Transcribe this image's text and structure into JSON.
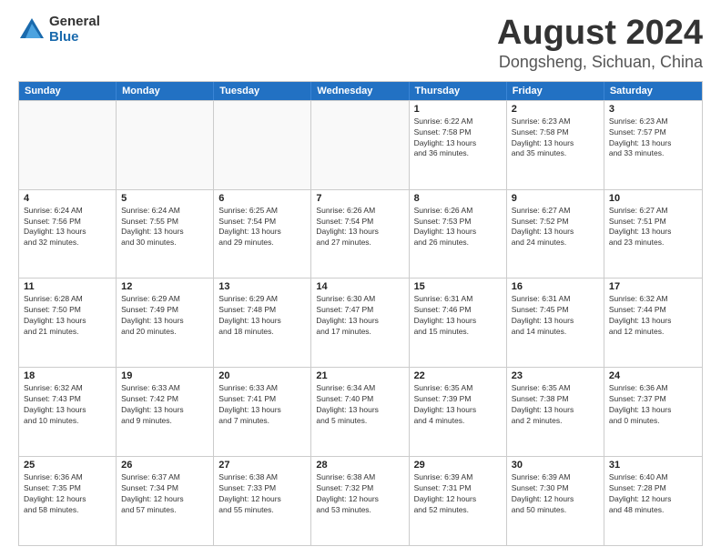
{
  "header": {
    "logo_general": "General",
    "logo_blue": "Blue",
    "month_title": "August 2024",
    "location": "Dongsheng, Sichuan, China"
  },
  "days_of_week": [
    "Sunday",
    "Monday",
    "Tuesday",
    "Wednesday",
    "Thursday",
    "Friday",
    "Saturday"
  ],
  "weeks": [
    [
      {
        "day": "",
        "text": ""
      },
      {
        "day": "",
        "text": ""
      },
      {
        "day": "",
        "text": ""
      },
      {
        "day": "",
        "text": ""
      },
      {
        "day": "1",
        "text": "Sunrise: 6:22 AM\nSunset: 7:58 PM\nDaylight: 13 hours\nand 36 minutes."
      },
      {
        "day": "2",
        "text": "Sunrise: 6:23 AM\nSunset: 7:58 PM\nDaylight: 13 hours\nand 35 minutes."
      },
      {
        "day": "3",
        "text": "Sunrise: 6:23 AM\nSunset: 7:57 PM\nDaylight: 13 hours\nand 33 minutes."
      }
    ],
    [
      {
        "day": "4",
        "text": "Sunrise: 6:24 AM\nSunset: 7:56 PM\nDaylight: 13 hours\nand 32 minutes."
      },
      {
        "day": "5",
        "text": "Sunrise: 6:24 AM\nSunset: 7:55 PM\nDaylight: 13 hours\nand 30 minutes."
      },
      {
        "day": "6",
        "text": "Sunrise: 6:25 AM\nSunset: 7:54 PM\nDaylight: 13 hours\nand 29 minutes."
      },
      {
        "day": "7",
        "text": "Sunrise: 6:26 AM\nSunset: 7:54 PM\nDaylight: 13 hours\nand 27 minutes."
      },
      {
        "day": "8",
        "text": "Sunrise: 6:26 AM\nSunset: 7:53 PM\nDaylight: 13 hours\nand 26 minutes."
      },
      {
        "day": "9",
        "text": "Sunrise: 6:27 AM\nSunset: 7:52 PM\nDaylight: 13 hours\nand 24 minutes."
      },
      {
        "day": "10",
        "text": "Sunrise: 6:27 AM\nSunset: 7:51 PM\nDaylight: 13 hours\nand 23 minutes."
      }
    ],
    [
      {
        "day": "11",
        "text": "Sunrise: 6:28 AM\nSunset: 7:50 PM\nDaylight: 13 hours\nand 21 minutes."
      },
      {
        "day": "12",
        "text": "Sunrise: 6:29 AM\nSunset: 7:49 PM\nDaylight: 13 hours\nand 20 minutes."
      },
      {
        "day": "13",
        "text": "Sunrise: 6:29 AM\nSunset: 7:48 PM\nDaylight: 13 hours\nand 18 minutes."
      },
      {
        "day": "14",
        "text": "Sunrise: 6:30 AM\nSunset: 7:47 PM\nDaylight: 13 hours\nand 17 minutes."
      },
      {
        "day": "15",
        "text": "Sunrise: 6:31 AM\nSunset: 7:46 PM\nDaylight: 13 hours\nand 15 minutes."
      },
      {
        "day": "16",
        "text": "Sunrise: 6:31 AM\nSunset: 7:45 PM\nDaylight: 13 hours\nand 14 minutes."
      },
      {
        "day": "17",
        "text": "Sunrise: 6:32 AM\nSunset: 7:44 PM\nDaylight: 13 hours\nand 12 minutes."
      }
    ],
    [
      {
        "day": "18",
        "text": "Sunrise: 6:32 AM\nSunset: 7:43 PM\nDaylight: 13 hours\nand 10 minutes."
      },
      {
        "day": "19",
        "text": "Sunrise: 6:33 AM\nSunset: 7:42 PM\nDaylight: 13 hours\nand 9 minutes."
      },
      {
        "day": "20",
        "text": "Sunrise: 6:33 AM\nSunset: 7:41 PM\nDaylight: 13 hours\nand 7 minutes."
      },
      {
        "day": "21",
        "text": "Sunrise: 6:34 AM\nSunset: 7:40 PM\nDaylight: 13 hours\nand 5 minutes."
      },
      {
        "day": "22",
        "text": "Sunrise: 6:35 AM\nSunset: 7:39 PM\nDaylight: 13 hours\nand 4 minutes."
      },
      {
        "day": "23",
        "text": "Sunrise: 6:35 AM\nSunset: 7:38 PM\nDaylight: 13 hours\nand 2 minutes."
      },
      {
        "day": "24",
        "text": "Sunrise: 6:36 AM\nSunset: 7:37 PM\nDaylight: 13 hours\nand 0 minutes."
      }
    ],
    [
      {
        "day": "25",
        "text": "Sunrise: 6:36 AM\nSunset: 7:35 PM\nDaylight: 12 hours\nand 58 minutes."
      },
      {
        "day": "26",
        "text": "Sunrise: 6:37 AM\nSunset: 7:34 PM\nDaylight: 12 hours\nand 57 minutes."
      },
      {
        "day": "27",
        "text": "Sunrise: 6:38 AM\nSunset: 7:33 PM\nDaylight: 12 hours\nand 55 minutes."
      },
      {
        "day": "28",
        "text": "Sunrise: 6:38 AM\nSunset: 7:32 PM\nDaylight: 12 hours\nand 53 minutes."
      },
      {
        "day": "29",
        "text": "Sunrise: 6:39 AM\nSunset: 7:31 PM\nDaylight: 12 hours\nand 52 minutes."
      },
      {
        "day": "30",
        "text": "Sunrise: 6:39 AM\nSunset: 7:30 PM\nDaylight: 12 hours\nand 50 minutes."
      },
      {
        "day": "31",
        "text": "Sunrise: 6:40 AM\nSunset: 7:28 PM\nDaylight: 12 hours\nand 48 minutes."
      }
    ]
  ]
}
